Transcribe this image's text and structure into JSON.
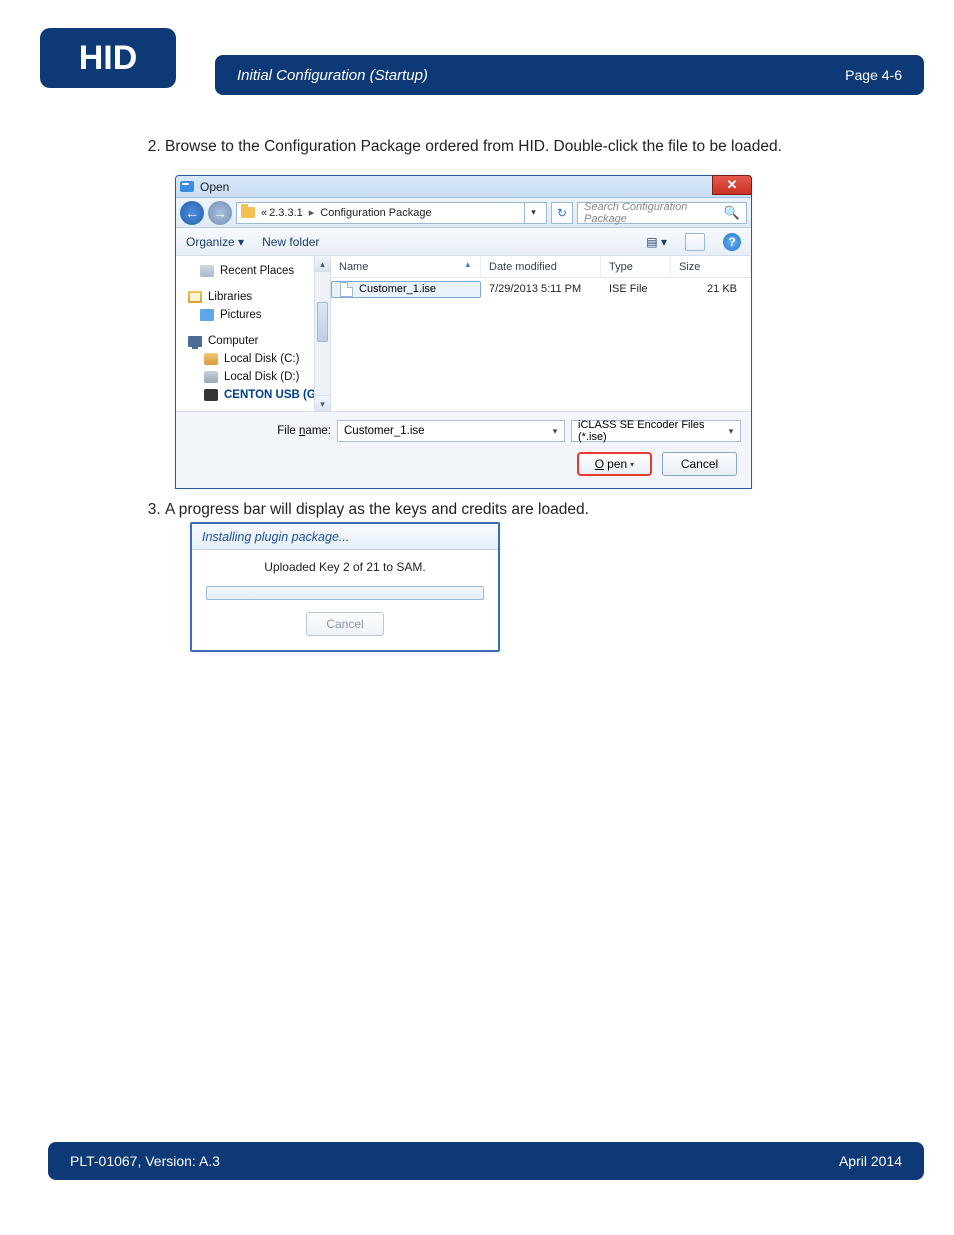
{
  "logo_text": "HID",
  "header": {
    "title": "Initial Configuration (Startup)",
    "page": "Page 4-6"
  },
  "steps": {
    "n2": "Browse to the Configuration Package ordered from HID. Double-click the file to be loaded.",
    "n3": "A progress bar will display as the keys and credits are loaded."
  },
  "open_dialog": {
    "title": "Open",
    "close": "✕",
    "nav": {
      "back": "←",
      "fwd": "→",
      "crumb_prefix": "«",
      "crumb1": "2.3.3.1",
      "crumb2": "Configuration Package",
      "dd": "▾",
      "refresh": "↻"
    },
    "search": {
      "placeholder": "Search Configuration Package",
      "icon": "🔍"
    },
    "toolbar": {
      "organize": "Organize ▾",
      "newfolder": "New folder",
      "views": "▤ ▾",
      "help": "?"
    },
    "sidebar": {
      "recent": "Recent Places",
      "libraries": "Libraries",
      "pictures": "Pictures",
      "computer": "Computer",
      "localc": "Local Disk (C:)",
      "locald": "Local Disk (D:)",
      "usb": "CENTON USB (G:)"
    },
    "columns": {
      "name": "Name",
      "date": "Date modified",
      "type": "Type",
      "size": "Size"
    },
    "file": {
      "name": "Customer_1.ise",
      "date": "7/29/2013 5:11 PM",
      "type": "ISE File",
      "size": "21 KB"
    },
    "filename_label_pre": "File ",
    "filename_label_u": "n",
    "filename_label_post": "ame:",
    "filename_value": "Customer_1.ise",
    "filetype": "iCLASS SE Encoder Files (*.ise)",
    "open_btn_u": "O",
    "open_btn_rest": "pen",
    "cancel_btn": "Cancel"
  },
  "progress": {
    "title": "Installing plugin package...",
    "message": "Uploaded Key 2 of 21 to SAM.",
    "cancel": "Cancel"
  },
  "footer": {
    "left": "PLT-01067, Version: A.3",
    "right": "April 2014"
  }
}
